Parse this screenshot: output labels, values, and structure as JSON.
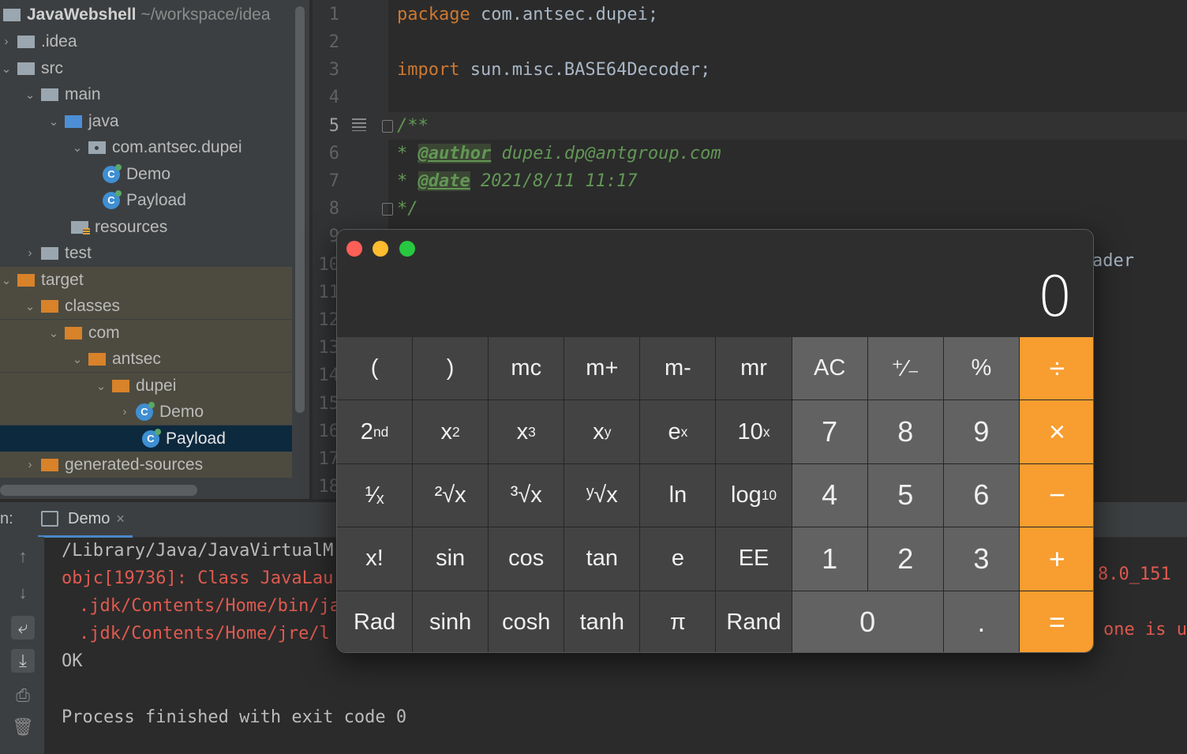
{
  "project": {
    "name": "JavaWebshell",
    "path_hint": "~/workspace/idea",
    "items": [
      {
        "label": ".idea"
      },
      {
        "label": "src"
      },
      {
        "label": "main"
      },
      {
        "label": "java"
      },
      {
        "label": "com.antsec.dupei"
      },
      {
        "label": "Demo"
      },
      {
        "label": "Payload"
      },
      {
        "label": "resources"
      },
      {
        "label": "test"
      },
      {
        "label": "target"
      },
      {
        "label": "classes"
      },
      {
        "label": "com"
      },
      {
        "label": "antsec"
      },
      {
        "label": "dupei"
      },
      {
        "label": "Demo"
      },
      {
        "label": "Payload"
      },
      {
        "label": "generated-sources"
      }
    ],
    "class_icon_letter": "C"
  },
  "editor": {
    "line_numbers": [
      "1",
      "2",
      "3",
      "4",
      "5",
      "6",
      "7",
      "8",
      "9",
      "10",
      "11",
      "12",
      "13",
      "14",
      "15",
      "16",
      "17",
      "18"
    ],
    "code": {
      "l1_kw": "package",
      "l1_rest": " com.antsec.dupei;",
      "l3_kw": "import",
      "l3_rest": " sun.misc.BASE64Decoder;",
      "l5": "/**",
      "l6_star": " * ",
      "l6_tag": "@author",
      "l6_rest": " dupei.dp@antgroup.com",
      "l7_star": " * ",
      "l7_tag": "@date",
      "l7_rest": " 2021/8/11 11:17",
      "l8": " */",
      "l10_clip": "ader"
    }
  },
  "run": {
    "label": "n:",
    "tab": "Demo",
    "tab_close": "×",
    "console": [
      "/Library/Java/JavaVirtualM",
      "objc[19736]: Class JavaLau",
      ".jdk/Contents/Home/bin/ja",
      ".jdk/Contents/Home/jre/l",
      "OK",
      "Process finished with exit code 0"
    ],
    "right_clip_1": "8.0_151",
    "right_clip_2": "one is u"
  },
  "calculator": {
    "display": "0",
    "colors": {
      "close": "#fe5f57",
      "minimize": "#febc2e",
      "zoom": "#28c840",
      "operator": "#f89d2f"
    },
    "row1": [
      "(",
      ")",
      "mc",
      "m+",
      "m-",
      "mr",
      "AC",
      "⁺∕₋",
      "%",
      "÷"
    ],
    "row2_mid": [
      "7",
      "8",
      "9",
      "×"
    ],
    "row3": [
      "ln"
    ],
    "row3_mid": [
      "4",
      "5",
      "6",
      "−"
    ],
    "row4": [
      "x!",
      "sin",
      "cos",
      "tan",
      "e",
      "EE",
      "1",
      "2",
      "3",
      "+"
    ],
    "row5": [
      "Rad",
      "sinh",
      "cosh",
      "tanh",
      "π",
      "Rand",
      "0",
      ".",
      "="
    ],
    "sci": {
      "second": "2",
      "second_sup": "nd",
      "x2": "x",
      "x2_sup": "2",
      "x3": "x",
      "x3_sup": "3",
      "xy": "x",
      "xy_sup": "y",
      "ex": "e",
      "ex_sup": "x",
      "tenx": "10",
      "tenx_sup": "x",
      "recip": "¹⁄ₓ",
      "sqrt2": "²√x",
      "sqrt3": "³√x",
      "sqrty": "ʸ√x",
      "log": "log",
      "log_sub": "10"
    }
  }
}
